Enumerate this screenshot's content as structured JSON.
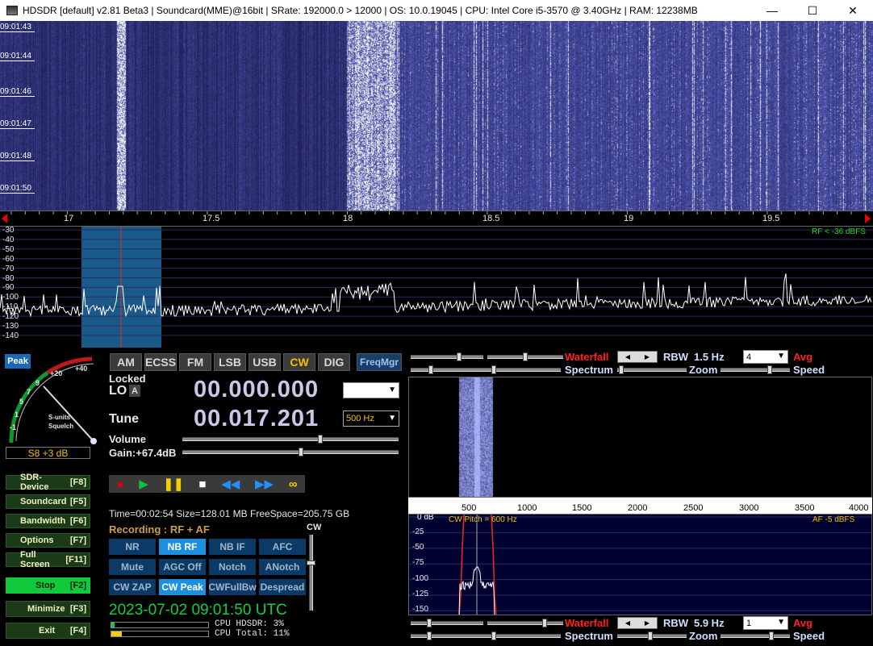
{
  "window": {
    "title": "HDSDR  [default]  v2.81 Beta3  |  Soundcard(MME)@16bit  |  SRate: 192000.0 > 12000  |  OS: 10.0.19045  |  CPU: Intel Core i5-3570 @ 3.40GHz  |  RAM: 12238MB",
    "minimize": "—",
    "maximize": "☐",
    "close": "✕"
  },
  "waterfall": {
    "time_labels": [
      "09:01:43",
      "09:01:44",
      "09:01:46",
      "09:01:47",
      "09:01:48",
      "09:01:50"
    ]
  },
  "freq_scale": {
    "labels": [
      "17",
      "17.5",
      "18",
      "18.5",
      "19",
      "19.5"
    ]
  },
  "spectrum": {
    "db_labels": [
      "-30",
      "-40",
      "-50",
      "-60",
      "-70",
      "-80",
      "-90",
      "-100",
      "-110",
      "-120",
      "-130",
      "-140"
    ],
    "rf_level": "RF < -36 dBFS"
  },
  "smeter": {
    "peak_label": "Peak",
    "scale_labels": [
      "1",
      "3",
      "5",
      "7",
      "9",
      "+20",
      "+40"
    ],
    "top_labels": [
      "+40"
    ],
    "caption1": "S-units",
    "caption2": "Squelch",
    "reading": "S8 +3 dB",
    "extra_scale": [
      "-1"
    ]
  },
  "left_buttons": [
    {
      "label": "SDR-Device",
      "key": "[F8]"
    },
    {
      "label": "Soundcard",
      "key": "[F5]"
    },
    {
      "label": "Bandwidth",
      "key": "[F6]"
    },
    {
      "label": "Options",
      "key": "[F7]"
    },
    {
      "label": "Full Screen",
      "key": "[F11]"
    },
    {
      "label": "Stop",
      "key": "[F2]"
    },
    {
      "label": "Minimize",
      "key": "[F3]"
    },
    {
      "label": "Exit",
      "key": "[F4]"
    }
  ],
  "modes": [
    "AM",
    "ECSS",
    "FM",
    "LSB",
    "USB",
    "CW",
    "DIG"
  ],
  "active_mode": "CW",
  "freqmgr": "FreqMgr",
  "lo": {
    "locked": "Locked",
    "lo": "LO",
    "a": "A",
    "value": "00.000.000"
  },
  "tune": {
    "label": "Tune",
    "value": "00.017.201",
    "step": "500 Hz"
  },
  "volume": {
    "label": "Volume"
  },
  "gain": {
    "label": "Gain:+67.4dB"
  },
  "recorder": {
    "info": "Time=00:02:54  Size=128.01 MB  FreeSpace=205.75 GB",
    "recording": "Recording : RF + AF"
  },
  "dsp_buttons": [
    {
      "label": "NR",
      "on": false
    },
    {
      "label": "NB RF",
      "on": true
    },
    {
      "label": "NB IF",
      "on": false
    },
    {
      "label": "AFC",
      "on": false
    },
    {
      "label": "Mute",
      "on": false
    },
    {
      "label": "AGC Off",
      "on": false
    },
    {
      "label": "Notch",
      "on": false
    },
    {
      "label": "ANotch",
      "on": false
    },
    {
      "label": "CW ZAP",
      "on": false
    },
    {
      "label": "CW Peak",
      "on": true
    },
    {
      "label": "CWFullBw",
      "on": false
    },
    {
      "label": "Despread",
      "on": false
    }
  ],
  "cw_label": "CW",
  "clock": "2023-07-02   09:01:50 UTC",
  "cpu": {
    "hdsdr": "CPU HDSDR:  3%",
    "total": "CPU Total: 11%"
  },
  "rf_panel": {
    "waterfall": "Waterfall",
    "spectrum": "Spectrum",
    "rbw_label": "RBW",
    "rbw_value": "1.5 Hz",
    "zoom": "Zoom",
    "avg_value": "4",
    "avg": "Avg",
    "speed": "Speed"
  },
  "af_panel": {
    "x_labels": [
      "500",
      "1000",
      "1500",
      "2000",
      "2500",
      "3000",
      "3500",
      "4000"
    ],
    "db_labels": [
      "0 dB",
      "-25",
      "-50",
      "-75",
      "-100",
      "-125",
      "-150"
    ],
    "cw_pitch": "CW Pitch = 600 Hz",
    "af_level": "AF  -5 dBFS"
  },
  "af_controls": {
    "waterfall": "Waterfall",
    "spectrum": "Spectrum",
    "rbw_label": "RBW",
    "rbw_value": "5.9 Hz",
    "zoom": "Zoom",
    "avg_value": "1",
    "avg": "Avg",
    "speed": "Speed"
  },
  "colors": {
    "accent_red": "#ff2020",
    "accent_green": "#11c93c",
    "freq_digits": "#c8c8e8",
    "dsp_on": "#1d8fe0",
    "dsp_off": "#0c3a66"
  }
}
